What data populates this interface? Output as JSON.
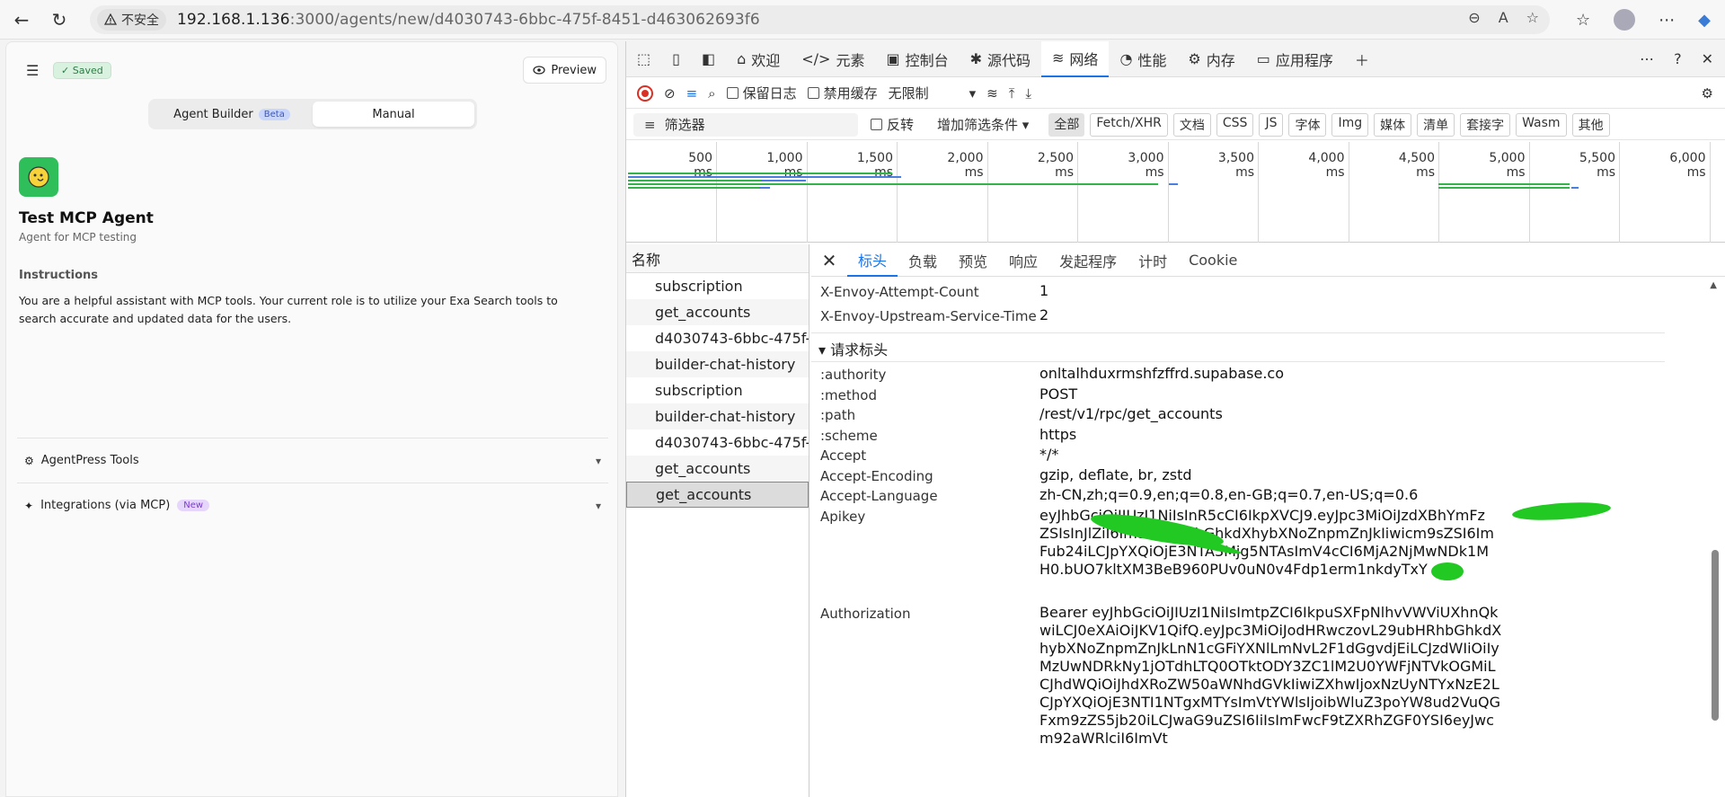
{
  "browser": {
    "insecure_label": "不安全",
    "url_host": "192.168.1.136",
    "url_rest": ":3000/agents/new/d4030743-6bbc-475f-8451-d463062693f6"
  },
  "app": {
    "saved_label": "Saved",
    "preview_label": "Preview",
    "mode_builder": "Agent Builder",
    "beta_label": "Beta",
    "mode_manual": "Manual",
    "agent_name": "Test MCP Agent",
    "agent_description": "Agent for MCP testing",
    "instructions_title": "Instructions",
    "instructions_text": "You are a helpful assistant with MCP tools. Your current role is to utilize your Exa Search tools to search accurate and updated data for the users.",
    "section_tools": "AgentPress Tools",
    "section_integrations": "Integrations (via MCP)",
    "new_label": "New"
  },
  "devtools": {
    "tabs": [
      "欢迎",
      "元素",
      "控制台",
      "源代码",
      "网络",
      "性能",
      "内存",
      "应用程序"
    ],
    "preserve_log": "保留日志",
    "disable_cache": "禁用缓存",
    "throttle": "无限制",
    "filter_placeholder": "筛选器",
    "invert": "反转",
    "more_filters": "增加筛选条件",
    "type_chips": [
      "全部",
      "Fetch/XHR",
      "文档",
      "CSS",
      "JS",
      "字体",
      "Img",
      "媒体",
      "清单",
      "套接字",
      "Wasm",
      "其他"
    ],
    "ticks": [
      "500 ms",
      "1,000 ms",
      "1,500 ms",
      "2,000 ms",
      "2,500 ms",
      "3,000 ms",
      "3,500 ms",
      "4,000 ms",
      "4,500 ms",
      "5,000 ms",
      "5,500 ms",
      "6,000 ms"
    ],
    "list_header": "名称",
    "requests": [
      "subscription",
      "get_accounts",
      "d4030743-6bbc-475f-84...",
      "builder-chat-history",
      "subscription",
      "builder-chat-history",
      "d4030743-6bbc-475f-84...",
      "get_accounts",
      "get_accounts"
    ],
    "detail_tabs": [
      "标头",
      "负载",
      "预览",
      "响应",
      "发起程序",
      "计时",
      "Cookie"
    ],
    "resp_headers": [
      {
        "name": "X-Envoy-Attempt-Count",
        "value": "1"
      },
      {
        "name": "X-Envoy-Upstream-Service-Time",
        "value": "2"
      }
    ],
    "request_section": "▾ 请求标头",
    "req_headers": [
      {
        "name": ":authority",
        "value": "onltalhduxrmshfzffrd.supabase.co"
      },
      {
        "name": ":method",
        "value": "POST"
      },
      {
        "name": ":path",
        "value": "/rest/v1/rpc/get_accounts"
      },
      {
        "name": ":scheme",
        "value": "https"
      },
      {
        "name": "Accept",
        "value": "*/*"
      },
      {
        "name": "Accept-Encoding",
        "value": "gzip, deflate, br, zstd"
      },
      {
        "name": "Accept-Language",
        "value": "zh-CN,zh;q=0.9,en;q=0.8,en-GB;q=0.7,en-US;q=0.6"
      }
    ],
    "apikey_name": "Apikey",
    "apikey_value": "eyJhbGciOiJIUzI1NiIsInR5cCI6IkpXVCJ9.eyJpc3MiOiJzdXBhYmFzZSIsInJlZiI6Im9ubHRhbGhkdXhybXNoZnpmZnJkIiwicm9sZSI6ImFub24iLCJpYXQiOjE3NTA3Mjg5NTAsImV4cCI6MjA2NjMwNDk1MH0.bUO7kltXM3BeB960PUv0uN0v4Fdp1erm1nkdyTxY",
    "auth_name": "Authorization",
    "auth_value": "Bearer eyJhbGciOiJIUzI1NiIsImtpZCI6IkpuSXFpNlhvVWViUXhnQkwiLCJ0eXAiOiJKV1QifQ.eyJpc3MiOiJodHRwczovL29ubHRhbGhkdXhybXNoZnpmZnJkLnN1cGFiYXNlLmNvL2F1dGgvdjEiLCJzdWIiOiIyMzUwNDRkNy1jOTdhLTQ0OTktODY3ZC1lM2U0YWFjNTVkOGMiLCJhdWQiOiJhdXRoZW50aWNhdGVkIiwiZXhwIjoxNzUyNTYxNzE2LCJpYXQiOjE3NTI1NTgxMTYsImVtYWlsIjoibWluZ3poYW8ud2VuQGFxm9zZS5jb20iLCJwaG9uZSI6IiIsImFwcF9tZXRhZGF0YSI6eyJwcm92aWRlciI6ImVt"
  }
}
